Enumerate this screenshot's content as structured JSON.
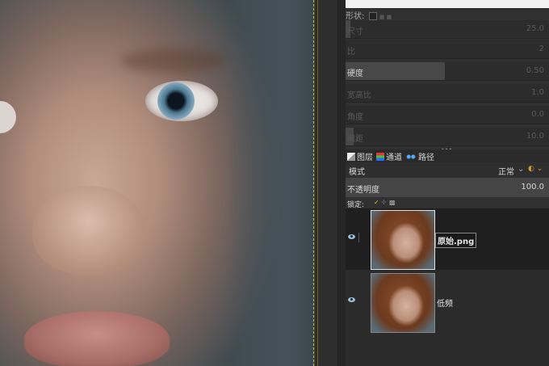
{
  "brush_options": {
    "shape_label": "形状:",
    "shape_hint": "■ ■",
    "sliders": [
      {
        "label": "尺寸",
        "value": "25.0",
        "level": 0.02,
        "active": false
      },
      {
        "label": "比",
        "value": "2",
        "level": 0.0,
        "active": false
      },
      {
        "label": "硬度",
        "value": "0.50",
        "level": 0.5,
        "active": true
      },
      {
        "label": "宽高比",
        "value": "1.0",
        "level": 0.0,
        "active": false
      },
      {
        "label": "角度",
        "value": "0.0",
        "level": 0.0,
        "active": false
      },
      {
        "label": "间距",
        "value": "10.0",
        "level": 0.04,
        "active": false
      }
    ]
  },
  "dock_tabs": [
    {
      "label": "图层",
      "icon": "layers-icon"
    },
    {
      "label": "通道",
      "icon": "channels-icon"
    },
    {
      "label": "路径",
      "icon": "paths-icon"
    }
  ],
  "layers_panel": {
    "mode_label": "模式",
    "mode_value": "正常",
    "opacity_label": "不透明度",
    "opacity_value": "100.0",
    "lock_label": "锁定:",
    "layers": [
      {
        "name": "原始.png",
        "visible": true,
        "selected": true
      },
      {
        "name": "低频",
        "visible": true,
        "selected": false
      }
    ]
  },
  "colors": {
    "guide": "#b9c232",
    "accent_orange": "#d59a2a"
  }
}
